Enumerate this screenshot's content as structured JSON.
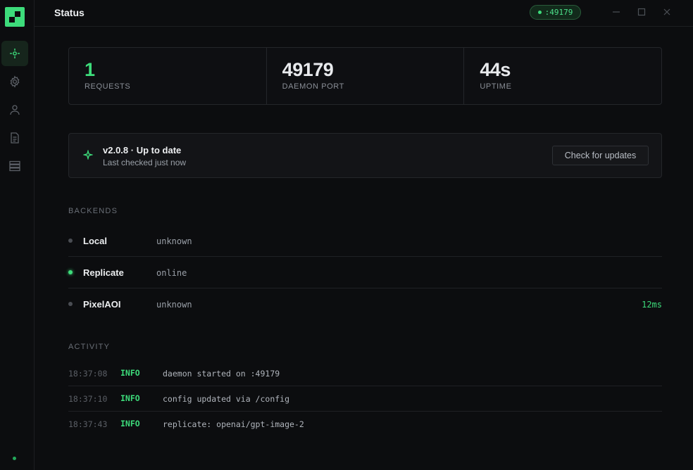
{
  "app": {
    "title": "Status",
    "port_pill": ":49179"
  },
  "sidebar": {
    "items": [
      {
        "name": "status",
        "icon": "crosshair-icon",
        "active": true
      },
      {
        "name": "settings",
        "icon": "gear-icon",
        "active": false
      },
      {
        "name": "account",
        "icon": "user-icon",
        "active": false
      },
      {
        "name": "logs",
        "icon": "document-icon",
        "active": false
      },
      {
        "name": "backends",
        "icon": "server-icon",
        "active": false
      }
    ]
  },
  "stats": [
    {
      "value": "1",
      "label": "REQUESTS"
    },
    {
      "value": "49179",
      "label": "DAEMON PORT"
    },
    {
      "value": "44s",
      "label": "UPTIME"
    }
  ],
  "update": {
    "version_line": "v2.0.8 · Up to date",
    "checked": "Last checked just now",
    "button": "Check for updates"
  },
  "backends": {
    "heading": "BACKENDS",
    "items": [
      {
        "name": "Local",
        "status": "unknown",
        "latency": ""
      },
      {
        "name": "Replicate",
        "status": "online",
        "latency": ""
      },
      {
        "name": "PixelAOI",
        "status": "unknown",
        "latency": "12ms"
      }
    ]
  },
  "activity": {
    "heading": "ACTIVITY",
    "items": [
      {
        "time": "18:37:08",
        "level": "INFO",
        "message": "daemon started on :49179"
      },
      {
        "time": "18:37:10",
        "level": "INFO",
        "message": "config updated via /config"
      },
      {
        "time": "18:37:43",
        "level": "INFO",
        "message": "replicate: openai/gpt-image-2"
      }
    ]
  },
  "colors": {
    "accent": "#3ddc7b",
    "background": "#0c0d0f",
    "border": "#24262a"
  }
}
